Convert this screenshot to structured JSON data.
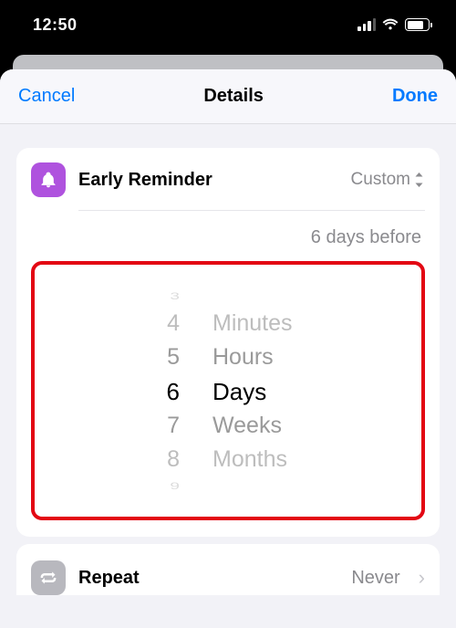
{
  "statusbar": {
    "time": "12:50"
  },
  "nav": {
    "cancel": "Cancel",
    "title": "Details",
    "done": "Done"
  },
  "earlyReminder": {
    "label": "Early Reminder",
    "mode": "Custom",
    "summary": "6 days before",
    "picker": {
      "numbers": {
        "farTop": "3",
        "above2": "4",
        "above1": "5",
        "selected": "6",
        "below1": "7",
        "below2": "8",
        "farBottom": "9"
      },
      "units": {
        "above2": "Minutes",
        "above1": "Hours",
        "selected": "Days",
        "below1": "Weeks",
        "below2": "Months"
      }
    }
  },
  "repeat": {
    "label": "Repeat",
    "value": "Never"
  }
}
